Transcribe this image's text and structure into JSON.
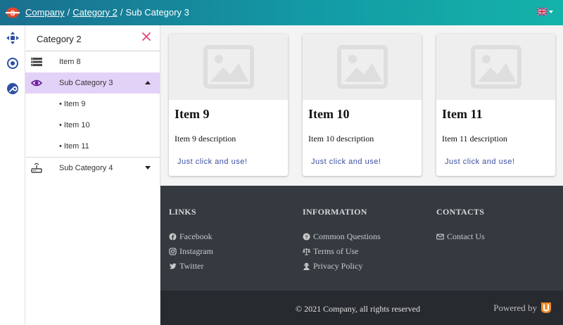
{
  "header": {
    "breadcrumb": [
      "Company",
      "Category 2",
      "Sub Category 3"
    ],
    "separator": "/",
    "language_icon": "uk-flag-icon",
    "brand_color": "#139aa5"
  },
  "rail": {
    "icons": [
      "move-arrows-icon",
      "target-icon",
      "wrench-icon"
    ],
    "accent_color": "#2d4fa3"
  },
  "panel": {
    "title": "Category 2",
    "close_icon": "close-icon",
    "items": [
      {
        "label": "Item 8",
        "icon": "list-icon"
      },
      {
        "label": "Sub Category 3",
        "icon": "eye-icon",
        "expanded": true,
        "children": [
          "• Item 9",
          "• Item 10",
          "• Item 11"
        ]
      },
      {
        "label": "Sub Category 4",
        "icon": "router-icon",
        "expanded": false
      }
    ],
    "active_color": "#e3d2f8"
  },
  "cards": [
    {
      "title": "Item 9",
      "description": "Item 9 description",
      "link": "Just click and use!"
    },
    {
      "title": "Item 10",
      "description": "Item 10 description",
      "link": "Just click and use!"
    },
    {
      "title": "Item 11",
      "description": "Item 11 description",
      "link": "Just click and use!"
    }
  ],
  "footer": {
    "links": {
      "heading": "LINKS",
      "items": [
        "Facebook",
        "Instagram",
        "Twitter"
      ]
    },
    "information": {
      "heading": "INFORMATION",
      "items": [
        "Common Questions",
        "Terms of Use",
        "Privacy Policy"
      ]
    },
    "contacts": {
      "heading": "CONTACTS",
      "items": [
        "Contact Us"
      ]
    },
    "copyright": "© 2021 Company, all rights reserved",
    "powered_by": "Powered by"
  }
}
